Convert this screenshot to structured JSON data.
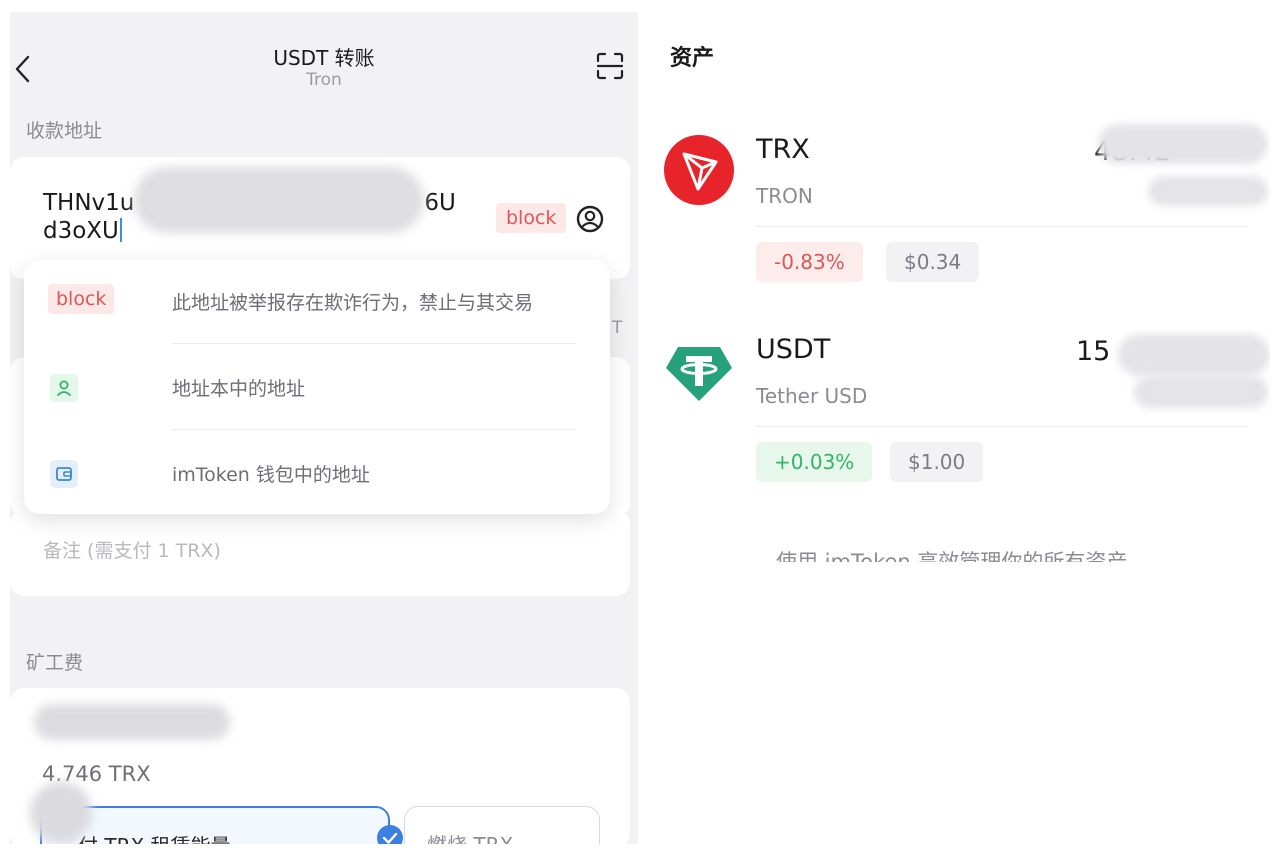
{
  "transfer": {
    "title": "USDT 转账",
    "network": "Tron",
    "address_label": "收款地址",
    "address_line1": "THNv1u",
    "address_mid": "6U",
    "address_line2": "d3oXU",
    "address_tag": "block",
    "side_letter": "T",
    "memo_placeholder": "备注 (需支付 1 TRX)",
    "fee_label": "矿工费",
    "fee_value": "4.746 TRX",
    "option_rent": "付 TRX 租赁能量",
    "option_burn": "燃烧 TRX"
  },
  "dropdown": {
    "items": [
      {
        "tag": "block",
        "text": "此地址被举报存在欺诈行为，禁止与其交易"
      },
      {
        "icon": "contact-icon",
        "text": "地址本中的地址"
      },
      {
        "icon": "wallet-icon",
        "text": "imToken 钱包中的地址"
      }
    ]
  },
  "assets": {
    "title": "资产",
    "tokens": [
      {
        "symbol": "TRX",
        "name": "TRON",
        "balance_partial": "48.42",
        "change": "-0.83%",
        "price": "$0.34",
        "icon": "tron-icon"
      },
      {
        "symbol": "USDT",
        "name": "Tether USD",
        "balance_partial": "15",
        "change": "+0.03%",
        "price": "$1.00",
        "icon": "tether-icon"
      }
    ],
    "footer": "使用 imToken 高效管理你的所有资产"
  },
  "colors": {
    "negative": "#e05555",
    "positive": "#34b36a",
    "tron_red": "#e6242a",
    "tether_green": "#26a17b",
    "accent_blue": "#3b7fe0"
  }
}
